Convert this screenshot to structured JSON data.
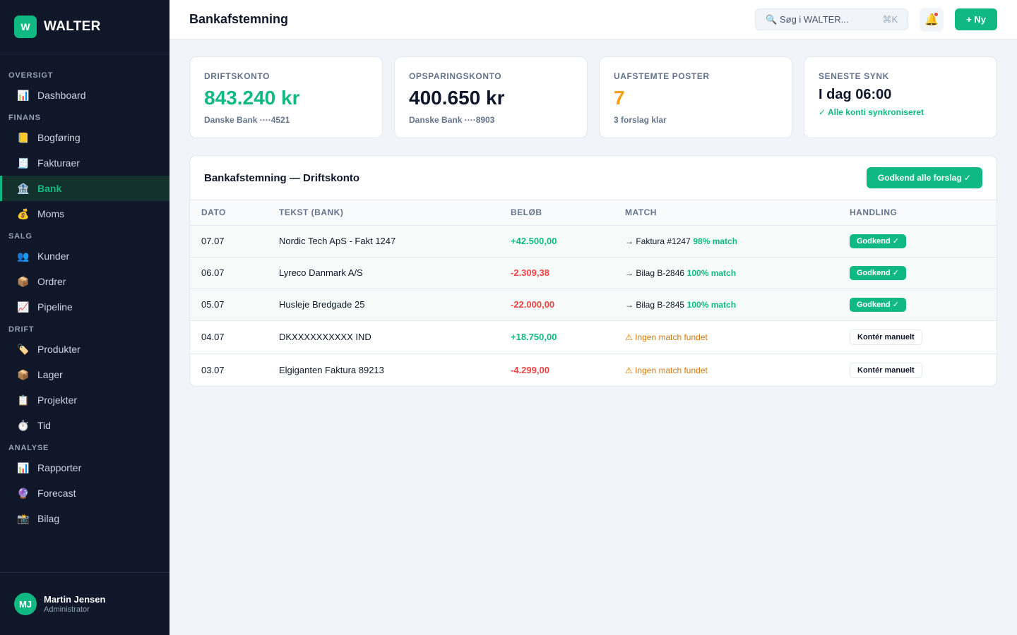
{
  "app": {
    "logo_letter": "W",
    "name": "WALTER"
  },
  "sidebar": {
    "sections": [
      {
        "title": "OVERSIGT",
        "items": [
          {
            "icon": "chart-icon",
            "glyph": "📊",
            "label": "Dashboard",
            "active": false
          }
        ]
      },
      {
        "title": "FINANS",
        "items": [
          {
            "icon": "ledger-icon",
            "glyph": "📒",
            "label": "Bogføring",
            "active": false
          },
          {
            "icon": "receipt-icon",
            "glyph": "🧾",
            "label": "Fakturaer",
            "active": false
          },
          {
            "icon": "bank-icon",
            "glyph": "🏦",
            "label": "Bank",
            "active": true
          },
          {
            "icon": "money-bag-icon",
            "glyph": "💰",
            "label": "Moms",
            "active": false
          }
        ]
      },
      {
        "title": "SALG",
        "items": [
          {
            "icon": "people-icon",
            "glyph": "👥",
            "label": "Kunder",
            "active": false
          },
          {
            "icon": "box-icon",
            "glyph": "📦",
            "label": "Ordrer",
            "active": false
          },
          {
            "icon": "trend-icon",
            "glyph": "📈",
            "label": "Pipeline",
            "active": false
          }
        ]
      },
      {
        "title": "DRIFT",
        "items": [
          {
            "icon": "tag-icon",
            "glyph": "🏷️",
            "label": "Produkter",
            "active": false
          },
          {
            "icon": "box-icon",
            "glyph": "📦",
            "label": "Lager",
            "active": false
          },
          {
            "icon": "clipboard-icon",
            "glyph": "📋",
            "label": "Projekter",
            "active": false
          },
          {
            "icon": "stopwatch-icon",
            "glyph": "⏱️",
            "label": "Tid",
            "active": false
          }
        ]
      },
      {
        "title": "ANALYSE",
        "items": [
          {
            "icon": "chart-icon",
            "glyph": "📊",
            "label": "Rapporter",
            "active": false
          },
          {
            "icon": "crystal-ball-icon",
            "glyph": "🔮",
            "label": "Forecast",
            "active": false
          },
          {
            "icon": "camera-icon",
            "glyph": "📸",
            "label": "Bilag",
            "active": false
          }
        ]
      }
    ]
  },
  "user": {
    "initials": "MJ",
    "name": "Martin Jensen",
    "role": "Administrator"
  },
  "header": {
    "title": "Bankafstemning",
    "search_text": "🔍 Søg i WALTER...",
    "search_shortcut": "⌘K",
    "bell_glyph": "🔔",
    "new_button": "+ Ny"
  },
  "cards": [
    {
      "label": "DRIFTSKONTO",
      "value": "843.240 kr",
      "sub": "Danske Bank ····4521",
      "tone": "green"
    },
    {
      "label": "OPSPARINGSKONTO",
      "value": "400.650 kr",
      "sub": "Danske Bank ····8903",
      "tone": "default"
    },
    {
      "label": "UAFSTEMTE POSTER",
      "value": "7",
      "sub": "3 forslag klar",
      "tone": "amber"
    },
    {
      "label": "SENESTE SYNK",
      "value": "I dag 06:00",
      "sub": "✓ Alle konti synkroniseret",
      "tone": "sync"
    }
  ],
  "reconciliation": {
    "title": "Bankafstemning — Driftskonto",
    "approve_all": "Godkend alle forslag ✓",
    "columns": [
      "DATO",
      "TEKST (BANK)",
      "BELØB",
      "MATCH",
      "HANDLING"
    ],
    "rows": [
      {
        "date": "07.07",
        "text": "Nordic Tech ApS - Fakt 1247",
        "amount": "+42.500,00",
        "sign": "pos",
        "matched": true,
        "match_ref": "→ Faktura #1247",
        "match_pct": "98% match",
        "action": "Godkend ✓"
      },
      {
        "date": "06.07",
        "text": "Lyreco Danmark A/S",
        "amount": "-2.309,38",
        "sign": "neg",
        "matched": true,
        "match_ref": "→ Bilag B-2846",
        "match_pct": "100% match",
        "action": "Godkend ✓"
      },
      {
        "date": "05.07",
        "text": "Husleje Bredgade 25",
        "amount": "-22.000,00",
        "sign": "neg",
        "matched": true,
        "match_ref": "→ Bilag B-2845",
        "match_pct": "100% match",
        "action": "Godkend ✓"
      },
      {
        "date": "04.07",
        "text": "DKXXXXXXXXXX IND",
        "amount": "+18.750,00",
        "sign": "pos",
        "matched": false,
        "match_ref": "⚠ Ingen match fundet",
        "match_pct": "",
        "action": "Kontér manuelt"
      },
      {
        "date": "03.07",
        "text": "Elgiganten Faktura 89213",
        "amount": "-4.299,00",
        "sign": "neg",
        "matched": false,
        "match_ref": "⚠ Ingen match fundet",
        "match_pct": "",
        "action": "Kontér manuelt"
      }
    ]
  },
  "colors": {
    "accent": "#10b981",
    "sidebar_bg": "#0f1729",
    "negative": "#ef4444",
    "warning": "#d97706",
    "amber": "#f59e0b"
  }
}
